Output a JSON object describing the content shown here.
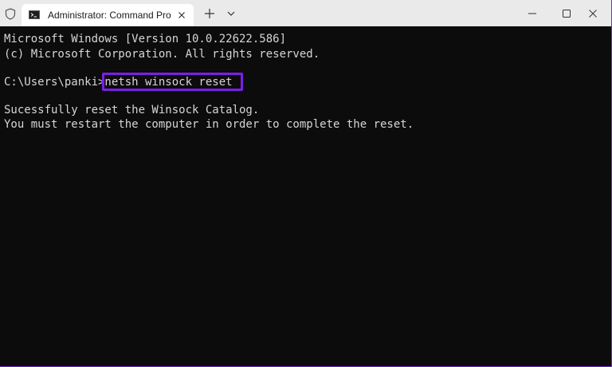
{
  "window": {
    "tab_title": "Administrator: Command Pro",
    "icons": {
      "shield": "shield-icon",
      "terminal": "terminal-icon",
      "close_tab": "close-icon",
      "new_tab": "plus-icon",
      "dropdown": "chevron-down-icon",
      "minimize": "minimize-icon",
      "maximize": "maximize-icon",
      "close_window": "close-icon"
    },
    "accent_color": "#7b1fe6"
  },
  "console": {
    "lines": [
      "Microsoft Windows [Version 10.0.22622.586]",
      "(c) Microsoft Corporation. All rights reserved.",
      "",
      "C:\\Users\\panki>netsh winsock reset",
      "",
      "Sucessfully reset the Winsock Catalog.",
      "You must restart the computer in order to complete the reset."
    ],
    "highlighted_command": "netsh winsock reset"
  }
}
